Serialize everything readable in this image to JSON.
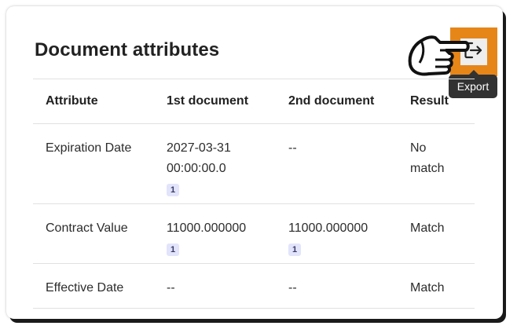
{
  "card": {
    "title": "Document attributes"
  },
  "toolbar": {
    "export_tooltip": "Export"
  },
  "table": {
    "headers": {
      "attribute": "Attribute",
      "doc1": "1st document",
      "doc2": "2nd document",
      "result": "Result"
    },
    "rows": [
      {
        "attribute": "Expiration Date",
        "doc1_line1": "2027-03-31",
        "doc1_line2": "00:00:00.0",
        "doc1_badge": "1",
        "doc2": "--",
        "result_line1": "No",
        "result_line2": "match"
      },
      {
        "attribute": "Contract Value",
        "doc1": "11000.000000",
        "doc1_badge": "1",
        "doc2": "11000.000000",
        "doc2_badge": "1",
        "result": "Match"
      },
      {
        "attribute": "Effective Date",
        "doc1": "--",
        "doc2": "--",
        "result": "Match"
      }
    ]
  },
  "colors": {
    "accent": "#e68619",
    "tooltip_bg": "#323232",
    "badge_bg": "#e2e4fb"
  },
  "icons": {
    "export": "export-icon",
    "pointer": "pointing-hand-icon"
  }
}
